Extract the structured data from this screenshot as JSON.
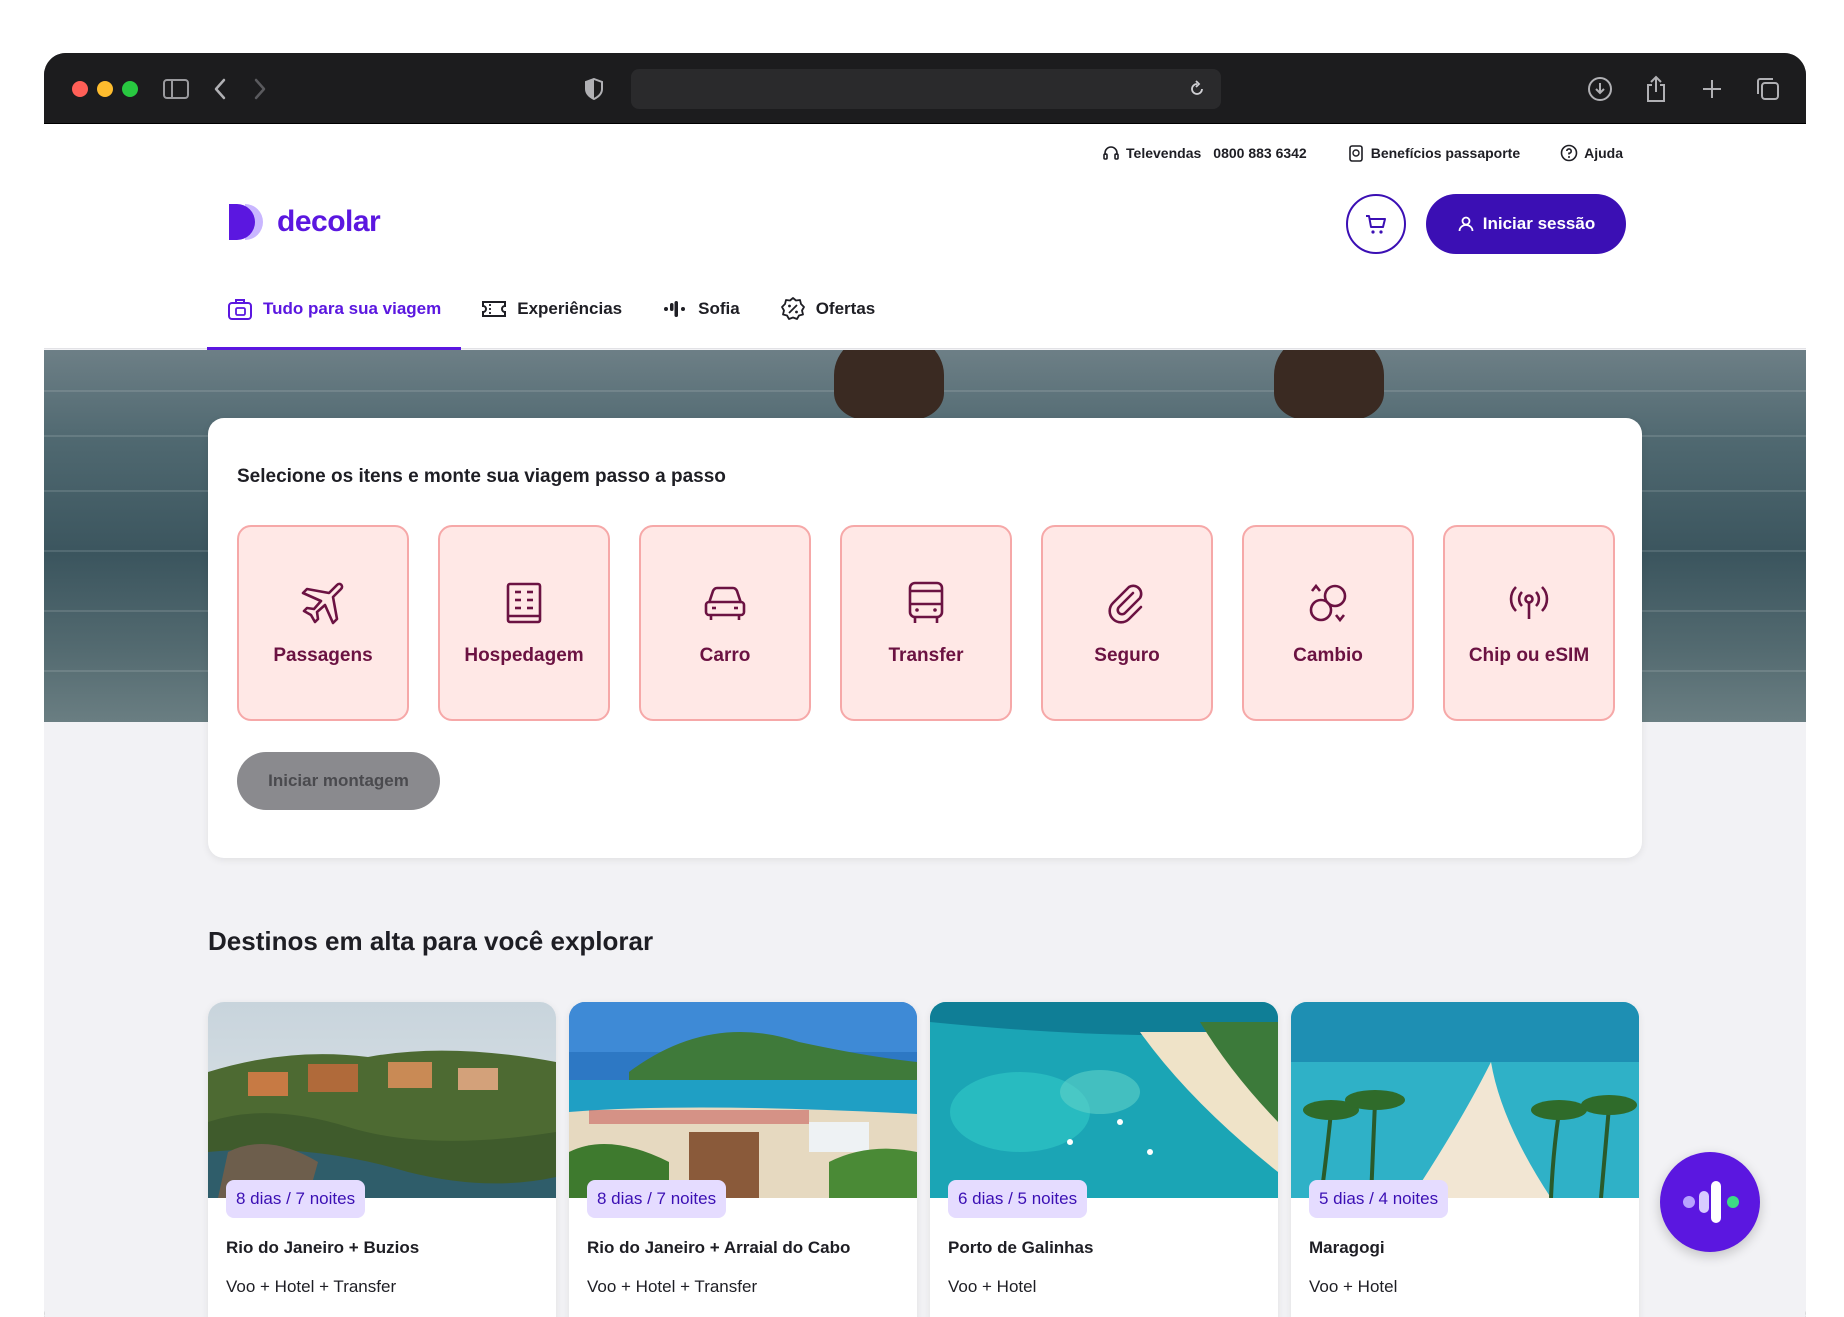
{
  "browser": {
    "traffic_lights": [
      "#ff5f57",
      "#febc2e",
      "#28c840"
    ],
    "url": ""
  },
  "topbar": {
    "televendas_label": "Televendas",
    "televendas_phone": "0800 883 6342",
    "beneficios_label": "Benefícios passaporte",
    "ajuda_label": "Ajuda"
  },
  "brand": {
    "name": "decolar",
    "color": "#5b17e0"
  },
  "header": {
    "login_label": "Iniciar sessão"
  },
  "nav": {
    "tabs": [
      {
        "label": "Tudo para sua viagem",
        "icon": "suitcase-icon",
        "active": true
      },
      {
        "label": "Experiências",
        "icon": "ticket-icon",
        "active": false
      },
      {
        "label": "Sofia",
        "icon": "sofia-icon",
        "active": false
      },
      {
        "label": "Ofertas",
        "icon": "discount-badge-icon",
        "active": false
      }
    ]
  },
  "builder": {
    "title": "Selecione os itens e monte sua viagem passo a passo",
    "items": [
      {
        "label": "Passagens",
        "icon": "airplane-icon"
      },
      {
        "label": "Hospedagem",
        "icon": "building-icon"
      },
      {
        "label": "Carro",
        "icon": "car-icon"
      },
      {
        "label": "Transfer",
        "icon": "bus-icon"
      },
      {
        "label": "Seguro",
        "icon": "paperclip-icon"
      },
      {
        "label": "Cambio",
        "icon": "currency-exchange-icon"
      },
      {
        "label": "Chip ou eSIM",
        "icon": "signal-icon"
      }
    ],
    "start_label": "Iniciar montagem"
  },
  "destinations": {
    "title": "Destinos em alta para você explorar",
    "cards": [
      {
        "badge": "8 dias / 7 noites",
        "name": "Rio do Janeiro + Buzios",
        "package": "Voo + Hotel + Transfer"
      },
      {
        "badge": "8 dias / 7 noites",
        "name": "Rio do Janeiro + Arraial do Cabo",
        "package": "Voo + Hotel + Transfer"
      },
      {
        "badge": "6 dias / 5 noites",
        "name": "Porto de Galinhas",
        "package": "Voo + Hotel"
      },
      {
        "badge": "5 dias / 4 noites",
        "name": "Maragogi",
        "package": "Voo + Hotel"
      }
    ]
  }
}
